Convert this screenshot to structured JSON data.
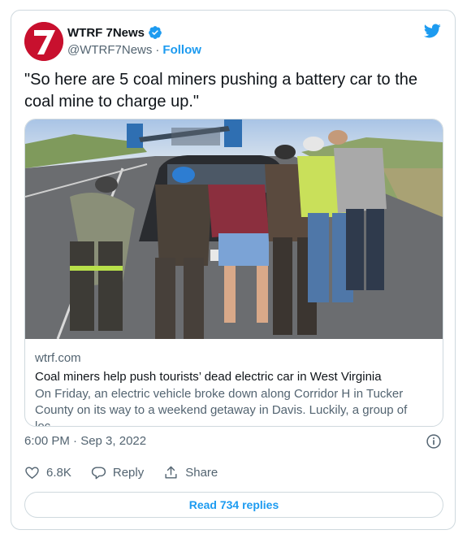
{
  "account": {
    "name": "WTRF 7News",
    "handle": "@WTRF7News",
    "follow_label": "Follow",
    "logo_text": "7"
  },
  "tweet": {
    "text": "\"So here are 5 coal miners pushing a battery car to the coal mine to charge up.\""
  },
  "link_card": {
    "domain": "wtrf.com",
    "headline": "Coal miners help push tourists’ dead electric car in West Virginia",
    "description": "On Friday, an electric vehicle broke down along Corridor H in Tucker County on its way to a weekend getaway in Davis. Luckily, a group of loc…"
  },
  "meta": {
    "timestamp": "6:00 PM · Sep 3, 2022"
  },
  "actions": {
    "like_count": "6.8K",
    "reply_label": "Reply",
    "share_label": "Share"
  },
  "footer": {
    "read_replies_label": "Read 734 replies"
  },
  "colors": {
    "accent": "#1d9bf0",
    "brand_red": "#c8102e",
    "muted": "#536471",
    "border": "#cfd9de"
  },
  "icons": [
    "verified-badge-icon",
    "twitter-bird-icon",
    "info-icon",
    "heart-icon",
    "reply-icon",
    "share-icon"
  ]
}
